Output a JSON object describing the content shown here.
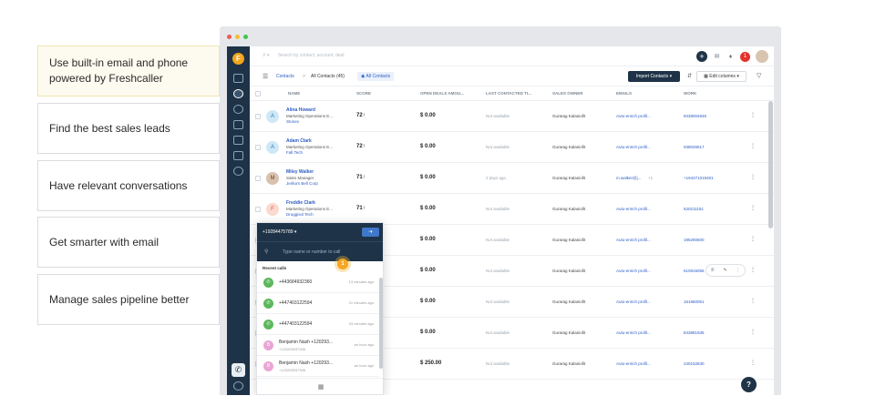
{
  "features": [
    {
      "label": "Use built-in email and phone powered by Freshcaller",
      "active": true
    },
    {
      "label": "Find the best sales leads",
      "active": false
    },
    {
      "label": "Have relevant conversations",
      "active": false
    },
    {
      "label": "Get smarter with email",
      "active": false
    },
    {
      "label": "Manage sales pipeline better",
      "active": false
    }
  ],
  "window_dots": [
    "#ee5b53",
    "#f4be2e",
    "#3fc74a"
  ],
  "app": {
    "logo": "F",
    "search_placeholder": "Search by contact, account, deal",
    "topbar": {
      "plus": "+",
      "notif_count": "1"
    },
    "breadcrumb": {
      "contacts": "Contacts",
      "separator": ">",
      "current": "All Contacts (45)",
      "view_tag": "All Contacts"
    },
    "import_button": "Import Contacts",
    "edit_columns": "Edit columns",
    "columns": [
      "Name",
      "Score",
      "Open deals amou...",
      "Last contacted ti...",
      "Sales owner",
      "Emails",
      "Work"
    ],
    "contacts": [
      {
        "initial": "A",
        "name": "Alina Howard",
        "title": "Marketing Operations E...",
        "company": "Stonex",
        "score": "72",
        "deal": "$ 0.00",
        "last": "Not available",
        "owner": "Gurarag Kalaniofit",
        "email": "Auto-enrich profil...",
        "work": "9438004849",
        "av_bg": "#cfe8f6",
        "av_fg": "#2c7cb5"
      },
      {
        "initial": "A",
        "name": "Adam Clark",
        "title": "Marketing Operations E...",
        "company": "Fall.Tech",
        "score": "72",
        "deal": "$ 0.00",
        "last": "Not available",
        "owner": "Gurarag Kalaniofit",
        "email": "Auto-enrich profil...",
        "work": "938026517",
        "av_bg": "#cfe8f6",
        "av_fg": "#2c7cb5"
      },
      {
        "initial": "M",
        "name": "Miley Walker",
        "title": "Sales Manager",
        "company": "Jerika's Bell Corp",
        "score": "71",
        "deal": "$ 0.00",
        "last": "2 days ago",
        "owner": "Gurarag Kalaniofit",
        "email": "m.walker@j...",
        "work": "+194271019401",
        "av_bg": "#d8c2ad",
        "av_fg": "#6b4a30"
      },
      {
        "initial": "F",
        "name": "Freddie Clark",
        "title": "Marketing Operations E...",
        "company": "Druggisol Tech",
        "score": "71",
        "deal": "$ 0.00",
        "last": "Not available",
        "owner": "Gurarag Kalaniofit",
        "email": "Auto-enrich profil...",
        "work": "520211151",
        "av_bg": "#fbd9cf",
        "av_fg": "#d0623e"
      },
      {
        "initial": "",
        "name": "",
        "title": "",
        "company": "",
        "score": "",
        "deal": "$ 0.00",
        "last": "Not available",
        "owner": "Gurarag Kalaniofit",
        "email": "Auto-enrich profil...",
        "work": "195280600",
        "av_bg": "#ffffff",
        "av_fg": "#ffffff"
      },
      {
        "initial": "",
        "name": "",
        "title": "",
        "company": "",
        "score": "",
        "deal": "$ 0.00",
        "last": "Not available",
        "owner": "Gurarag Kalaniofit",
        "email": "Auto-enrich profil...",
        "work": "610815056",
        "av_bg": "#ffffff",
        "av_fg": "#ffffff"
      },
      {
        "initial": "",
        "name": "",
        "title": "",
        "company": "",
        "score": "",
        "deal": "$ 0.00",
        "last": "Not available",
        "owner": "Gurarag Kalaniofit",
        "email": "Auto-enrich profil...",
        "work": "161860051",
        "av_bg": "#ffffff",
        "av_fg": "#ffffff"
      },
      {
        "initial": "",
        "name": "",
        "title": "",
        "company": "",
        "score": "",
        "deal": "$ 0.00",
        "last": "Not available",
        "owner": "Gurarag Kalaniofit",
        "email": "Auto-enrich profil...",
        "work": "843881936",
        "av_bg": "#ffffff",
        "av_fg": "#ffffff"
      },
      {
        "initial": "",
        "name": "",
        "title": "",
        "company": "",
        "score": "",
        "deal": "$ 250.00",
        "last": "Not available",
        "owner": "Gurarag Kalaniofit",
        "email": "Auto-enrich profil...",
        "work": "240152630",
        "av_bg": "#ffffff",
        "av_fg": "#ffffff"
      }
    ],
    "email_extra": "+1",
    "help": "?"
  },
  "phone": {
    "number": "+19284475789",
    "search_placeholder": "Type name or number to call",
    "recent_label": "Recent calls",
    "hint": "1",
    "calls": [
      {
        "initial": "",
        "name": "+443684932360",
        "sub": "",
        "time": "13 minutes ago",
        "color": "#5cb85c"
      },
      {
        "initial": "",
        "name": "+447403122594",
        "sub": "",
        "time": "21 minutes ago",
        "color": "#5cb85c"
      },
      {
        "initial": "",
        "name": "+447403122594",
        "sub": "",
        "time": "33 minutes ago",
        "color": "#5cb85c"
      },
      {
        "initial": "B",
        "name": "Benjamin Nash +120293...",
        "sub": "+120293037306",
        "time": "an hour ago",
        "color": "#e9a6d5"
      },
      {
        "initial": "B",
        "name": "Benjamin Nash +120293...",
        "sub": "+120293037306",
        "time": "an hour ago",
        "color": "#e9a6d5"
      }
    ]
  }
}
